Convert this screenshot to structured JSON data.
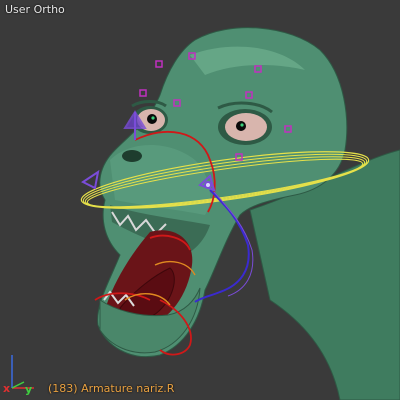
{
  "viewport": {
    "view_label": "User Ortho",
    "frame_text": "(183)",
    "object_text": "Armature nariz.R"
  },
  "axis_gizmo": {
    "x_label": "x",
    "y_label": "y"
  },
  "colors": {
    "background": "#3a3a3a",
    "skin": "#4f8f72",
    "skin_shadow": "#2e5a45",
    "mouth_interior": "#6a1418",
    "tongue": "#5a0c12",
    "eye_white": "#d8b5ad",
    "iris": "#0a0a0a",
    "pupil_glint": "#3ad07a",
    "bone_yellow": "#e6e14a",
    "bone_red": "#d01818",
    "bone_blue": "#3a2ad0",
    "bone_purple": "#7a4cd8",
    "marker_magenta": "#c030c0",
    "status_text": "#e8a040",
    "view_text": "#e6e6e6",
    "axis_x": "#e03030",
    "axis_y": "#40d040",
    "axis_z": "#3a6be0"
  },
  "icons": {
    "axis_gizmo": "axis-gizmo-icon",
    "bone_handle": "bone-handle-icon",
    "control_marker": "control-marker-icon"
  }
}
